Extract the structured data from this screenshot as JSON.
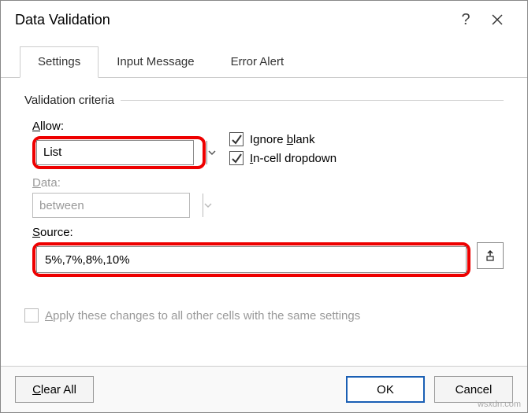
{
  "titlebar": {
    "title": "Data Validation",
    "help": "?",
    "close": "×"
  },
  "tabs": {
    "settings": "Settings",
    "input_message": "Input Message",
    "error_alert": "Error Alert"
  },
  "criteria": {
    "legend": "Validation criteria",
    "allow_label": "Allow:",
    "allow_value": "List",
    "data_label": "Data:",
    "data_value": "between",
    "source_label": "Source:",
    "source_value": "5%,7%,8%,10%"
  },
  "checks": {
    "ignore_blank": "Ignore blank",
    "in_cell_dropdown": "In-cell dropdown",
    "apply_same": "Apply these changes to all other cells with the same settings"
  },
  "footer": {
    "clear_all": "Clear All",
    "ok": "OK",
    "cancel": "Cancel"
  },
  "watermark": "wsxdn.com"
}
